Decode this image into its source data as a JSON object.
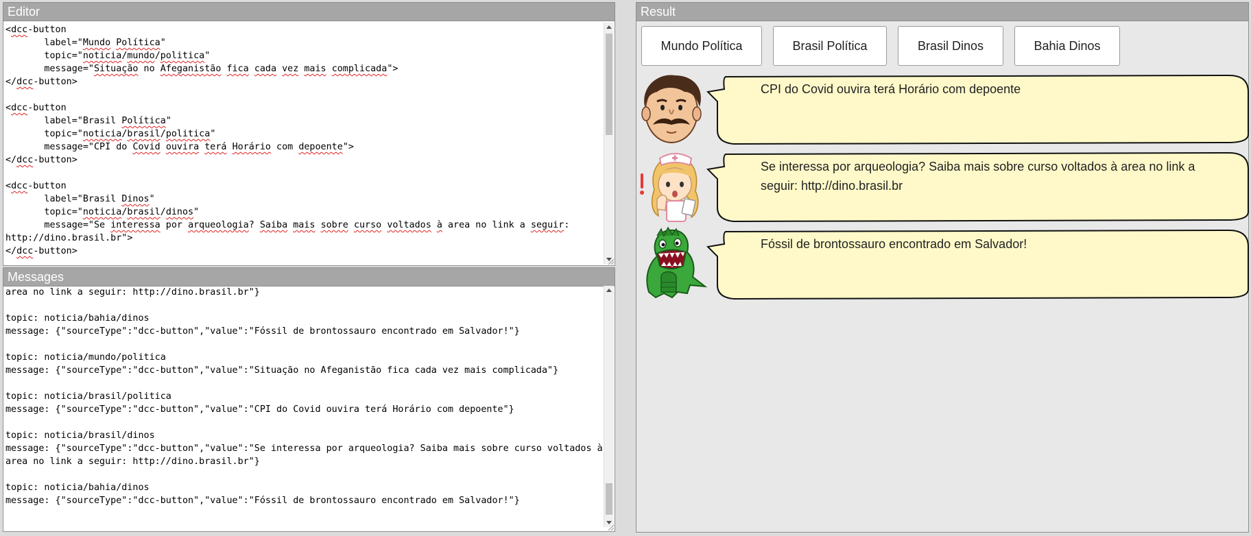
{
  "editor": {
    "title": "Editor",
    "lines": [
      [
        {
          "t": "<"
        },
        {
          "t": "dcc",
          "s": true
        },
        {
          "t": "-button"
        }
      ],
      [
        {
          "t": "       label=\""
        },
        {
          "t": "Mundo",
          "s": true
        },
        {
          "t": " "
        },
        {
          "t": "Política",
          "s": true
        },
        {
          "t": "\""
        }
      ],
      [
        {
          "t": "       topic=\""
        },
        {
          "t": "noticia",
          "s": true
        },
        {
          "t": "/"
        },
        {
          "t": "mundo",
          "s": true
        },
        {
          "t": "/"
        },
        {
          "t": "politica",
          "s": true
        },
        {
          "t": "\""
        }
      ],
      [
        {
          "t": "       message=\""
        },
        {
          "t": "Situação",
          "s": true
        },
        {
          "t": " no "
        },
        {
          "t": "Afeganistão",
          "s": true
        },
        {
          "t": " "
        },
        {
          "t": "fica",
          "s": true
        },
        {
          "t": " "
        },
        {
          "t": "cada",
          "s": true
        },
        {
          "t": " "
        },
        {
          "t": "vez",
          "s": true
        },
        {
          "t": " "
        },
        {
          "t": "mais",
          "s": true
        },
        {
          "t": " "
        },
        {
          "t": "complicada",
          "s": true
        },
        {
          "t": "\">"
        }
      ],
      [
        {
          "t": "</"
        },
        {
          "t": "dcc",
          "s": true
        },
        {
          "t": "-button>"
        }
      ],
      [
        {
          "t": ""
        }
      ],
      [
        {
          "t": "<"
        },
        {
          "t": "dcc",
          "s": true
        },
        {
          "t": "-button"
        }
      ],
      [
        {
          "t": "       label=\"Brasil "
        },
        {
          "t": "Política",
          "s": true
        },
        {
          "t": "\""
        }
      ],
      [
        {
          "t": "       topic=\""
        },
        {
          "t": "noticia",
          "s": true
        },
        {
          "t": "/"
        },
        {
          "t": "brasil",
          "s": true
        },
        {
          "t": "/"
        },
        {
          "t": "politica",
          "s": true
        },
        {
          "t": "\""
        }
      ],
      [
        {
          "t": "       message=\"CPI do "
        },
        {
          "t": "Covid",
          "s": true
        },
        {
          "t": " "
        },
        {
          "t": "ouvira",
          "s": true
        },
        {
          "t": " "
        },
        {
          "t": "terá",
          "s": true
        },
        {
          "t": " "
        },
        {
          "t": "Horário",
          "s": true
        },
        {
          "t": " com "
        },
        {
          "t": "depoente",
          "s": true
        },
        {
          "t": "\">"
        }
      ],
      [
        {
          "t": "</"
        },
        {
          "t": "dcc",
          "s": true
        },
        {
          "t": "-button>"
        }
      ],
      [
        {
          "t": ""
        }
      ],
      [
        {
          "t": "<"
        },
        {
          "t": "dcc",
          "s": true
        },
        {
          "t": "-button"
        }
      ],
      [
        {
          "t": "       label=\"Brasil "
        },
        {
          "t": "Dinos",
          "s": true
        },
        {
          "t": "\""
        }
      ],
      [
        {
          "t": "       topic=\""
        },
        {
          "t": "noticia",
          "s": true
        },
        {
          "t": "/"
        },
        {
          "t": "brasil",
          "s": true
        },
        {
          "t": "/"
        },
        {
          "t": "dinos",
          "s": true
        },
        {
          "t": "\""
        }
      ],
      [
        {
          "t": "       message=\"Se "
        },
        {
          "t": "interessa",
          "s": true
        },
        {
          "t": " por "
        },
        {
          "t": "arqueologia",
          "s": true
        },
        {
          "t": "? "
        },
        {
          "t": "Saiba",
          "s": true
        },
        {
          "t": " "
        },
        {
          "t": "mais",
          "s": true
        },
        {
          "t": " "
        },
        {
          "t": "sobre",
          "s": true
        },
        {
          "t": " "
        },
        {
          "t": "curso",
          "s": true
        },
        {
          "t": " "
        },
        {
          "t": "voltados",
          "s": true
        },
        {
          "t": " "
        },
        {
          "t": "à",
          "s": true
        },
        {
          "t": " area no link a "
        },
        {
          "t": "seguir",
          "s": true
        },
        {
          "t": ":"
        }
      ],
      [
        {
          "t": "http://dino.brasil.br\">"
        }
      ],
      [
        {
          "t": "</"
        },
        {
          "t": "dcc",
          "s": true
        },
        {
          "t": "-button>"
        }
      ]
    ]
  },
  "messages": {
    "title": "Messages",
    "lines": [
      "area no link a seguir: http://dino.brasil.br\"}",
      "",
      "topic: noticia/bahia/dinos",
      "message: {\"sourceType\":\"dcc-button\",\"value\":\"Fóssil de brontossauro encontrado em Salvador!\"}",
      "",
      "topic: noticia/mundo/politica",
      "message: {\"sourceType\":\"dcc-button\",\"value\":\"Situação no Afeganistão fica cada vez mais complicada\"}",
      "",
      "topic: noticia/brasil/politica",
      "message: {\"sourceType\":\"dcc-button\",\"value\":\"CPI do Covid ouvira terá Horário com depoente\"}",
      "",
      "topic: noticia/brasil/dinos",
      "message: {\"sourceType\":\"dcc-button\",\"value\":\"Se interessa por arqueologia? Saiba mais sobre curso voltados à",
      "area no link a seguir: http://dino.brasil.br\"}",
      "",
      "topic: noticia/bahia/dinos",
      "message: {\"sourceType\":\"dcc-button\",\"value\":\"Fóssil de brontossauro encontrado em Salvador!\"}"
    ]
  },
  "result": {
    "title": "Result",
    "buttons": [
      {
        "label": "Mundo Política"
      },
      {
        "label": "Brasil Política"
      },
      {
        "label": "Brasil Dinos"
      },
      {
        "label": "Bahia Dinos"
      }
    ],
    "bubbles": [
      {
        "avatar": "man-with-mustache-avatar",
        "text": "CPI do Covid ouvira terá Horário com depoente"
      },
      {
        "avatar": "nurse-avatar",
        "text": "Se interessa por arqueologia? Saiba mais sobre curso voltados à area no link a seguir: http://dino.brasil.br"
      },
      {
        "avatar": "dinosaur-avatar",
        "text": "Fóssil de brontossauro encontrado em Salvador!"
      }
    ]
  },
  "colors": {
    "panel_header": "#a6a6a6",
    "bubble_fill": "#fff9c9",
    "spellcheck_underline": "#e02020"
  }
}
